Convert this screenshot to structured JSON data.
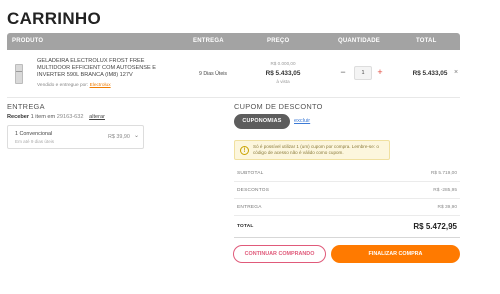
{
  "page_title": "CARRINHO",
  "table_headers": {
    "product": "PRODUTO",
    "delivery": "ENTREGA",
    "price": "PREÇO",
    "quantity": "QUANTIDADE",
    "total": "TOTAL"
  },
  "item": {
    "name": "GELADEIRA ELECTROLUX FROST FREE MULTIDOOR EFFICIENT COM AUTOSENSE E INVERTER 590L BRANCA (IM8) 127V",
    "seller_prefix": "Vendido e entregue por:",
    "seller_name": "Electrolux",
    "delivery": "9 Dias Úteis",
    "price_top": "R$ 0.000,00",
    "price": "R$ 5.433,05",
    "price_sub": "à vista",
    "quantity": "1",
    "minus": "−",
    "plus": "+",
    "total": "R$ 5.433,05",
    "remove": "×"
  },
  "shipping": {
    "title": "ENTREGA",
    "receive_label": "Receber",
    "receive_info": "1 item em",
    "cep": "29163-632",
    "change_link": "alterar",
    "option_name": "1 Convencional",
    "option_eta": "Em até 9 dias úteis",
    "option_price": "R$ 39,90",
    "chevron": "⌄"
  },
  "coupon": {
    "title": "CUPOM DE DESCONTO",
    "button": "CUPONOMIAS",
    "link": "excluir",
    "warning_icon": "!",
    "warning_text": "Só é possível utilizar 1 (um) cupom por compra. Lembre-se: o código de acesso não é válido como cupom."
  },
  "summary": {
    "subtotal_label": "SUBTOTAL",
    "subtotal_value": "R$ 5.719,00",
    "discounts_label": "DESCONTOS",
    "discounts_value": "R$ -285,95",
    "delivery_label": "ENTREGA",
    "delivery_value": "R$ 39,90",
    "total_label": "TOTAL",
    "total_value": "R$ 5.472,95"
  },
  "buttons": {
    "continue": "CONTINUAR COMPRANDO",
    "finish": "FINALIZAR COMPRA"
  },
  "colors": {
    "accent": "#ff7a00",
    "continue_border": "#e05a7a",
    "header_bg": "#a3a3a3",
    "coupon_button": "#5d5d5d"
  }
}
